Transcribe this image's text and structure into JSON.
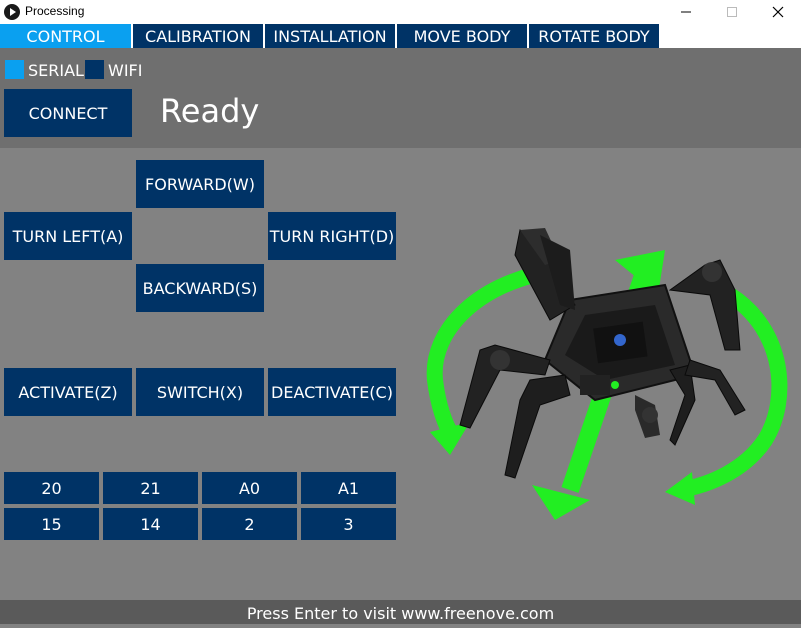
{
  "window": {
    "title": "Processing",
    "minimize_icon": "minimize-icon",
    "maximize_icon": "maximize-icon",
    "close_icon": "close-icon"
  },
  "tabs": [
    {
      "label": "CONTROL",
      "active": true
    },
    {
      "label": "CALIBRATION",
      "active": false
    },
    {
      "label": "INSTALLATION",
      "active": false
    },
    {
      "label": "MOVE BODY",
      "active": false
    },
    {
      "label": "ROTATE BODY",
      "active": false
    }
  ],
  "connection": {
    "serial_label": "SERIAL",
    "wifi_label": "WIFI",
    "selected": "SERIAL",
    "connect_label": "CONNECT",
    "status": "Ready"
  },
  "movement": {
    "forward": "FORWARD(W)",
    "turn_left": "TURN LEFT(A)",
    "turn_right": "TURN RIGHT(D)",
    "backward": "BACKWARD(S)"
  },
  "actions": {
    "activate": "ACTIVATE(Z)",
    "switch": "SWITCH(X)",
    "deactivate": "DEACTIVATE(C)"
  },
  "pins": {
    "row1": [
      "20",
      "21",
      "A0",
      "A1"
    ],
    "row2": [
      "15",
      "14",
      "2",
      "3"
    ]
  },
  "footer": {
    "text": "Press Enter to visit www.freenove.com"
  },
  "colors": {
    "button": "#003366",
    "active_tab": "#0aa0f0",
    "background": "#828282",
    "header": "#6f6f6f",
    "arrow_green": "#22ee22"
  },
  "illustration": {
    "description_icon": "hexapod-robot-icon"
  }
}
